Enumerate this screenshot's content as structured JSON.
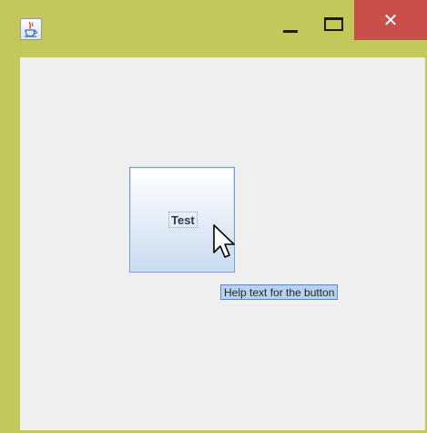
{
  "window": {
    "title_icon": "java-coffee-cup-icon",
    "controls": {
      "minimize_icon": "minimize-icon",
      "maximize_icon": "maximize-icon",
      "close_icon": "close-icon",
      "close_glyph": "✕"
    },
    "frame_color": "#c4c85a",
    "close_color": "#c94f4a"
  },
  "content": {
    "button_label": "Test",
    "tooltip_text": "Help text for the button",
    "background": "#efefef"
  }
}
